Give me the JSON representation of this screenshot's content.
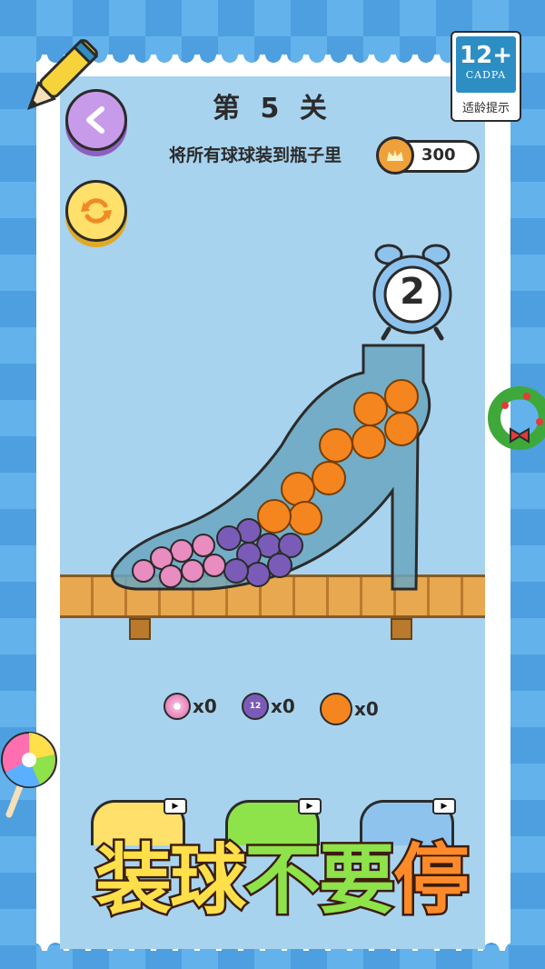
{
  "level": {
    "title": "第 5 关"
  },
  "instruction": "将所有球球装到瓶子里",
  "coins": {
    "value": "300"
  },
  "age_rating": {
    "number": "12+",
    "org": "CADPA",
    "label": "适龄提示"
  },
  "timer": {
    "value": "2"
  },
  "counters": [
    {
      "name": "pink-candy",
      "count": "x0"
    },
    {
      "name": "purple-12-ball",
      "count": "x0"
    },
    {
      "name": "orange-slice",
      "count": "x0"
    }
  ],
  "ball_label": "12",
  "banner": {
    "part1": "装球",
    "part2": "不要",
    "part3": "停"
  },
  "colors": {
    "frame_blue": "#5aa9e6",
    "play_area": "#a8d3ee",
    "bottle": "#6aa6bf",
    "orange": "#f5851f",
    "purple": "#7a5cb8",
    "pink": "#e98cc0",
    "back_button": "#c79bea",
    "restart_button": "#ffe06a"
  },
  "icons": [
    "back-arrow-icon",
    "restart-icon",
    "coin-icon",
    "alarm-clock-icon",
    "video-icon",
    "pencil-icon",
    "wreath-icon",
    "lollipop-icon"
  ]
}
